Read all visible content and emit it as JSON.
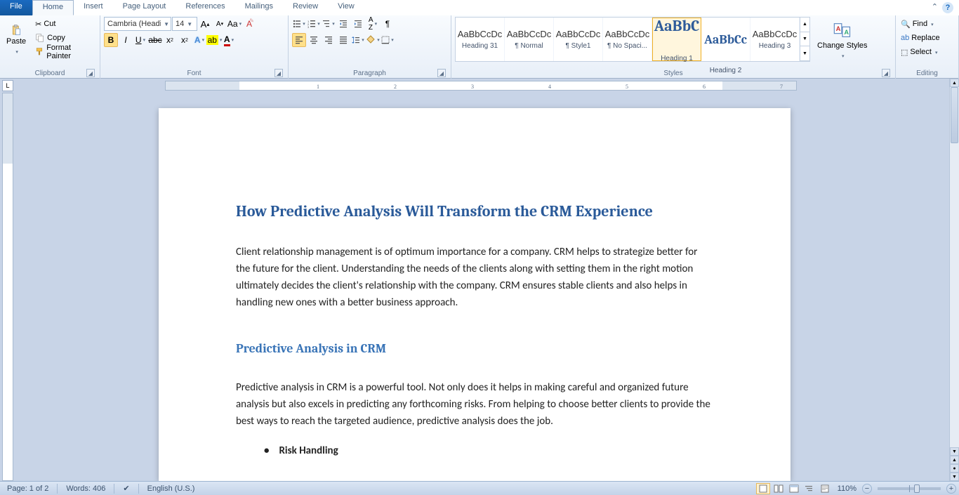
{
  "tabs": {
    "file": "File",
    "list": [
      "Home",
      "Insert",
      "Page Layout",
      "References",
      "Mailings",
      "Review",
      "View"
    ],
    "active": "Home"
  },
  "clipboard": {
    "paste": "Paste",
    "cut": "Cut",
    "copy": "Copy",
    "format_painter": "Format Painter",
    "group": "Clipboard"
  },
  "font": {
    "name": "Cambria (Headi",
    "size": "14",
    "group": "Font"
  },
  "paragraph": {
    "group": "Paragraph"
  },
  "styles": {
    "group": "Styles",
    "change": "Change Styles",
    "items": [
      {
        "prev": "AaBbCcDc",
        "name": "Heading 31",
        "cls": ""
      },
      {
        "prev": "AaBbCcDc",
        "name": "¶ Normal",
        "cls": ""
      },
      {
        "prev": "AaBbCcDc",
        "name": "¶ Style1",
        "cls": ""
      },
      {
        "prev": "AaBbCcDc",
        "name": "¶ No Spaci...",
        "cls": ""
      },
      {
        "prev": "AaBbC",
        "name": "Heading 1",
        "cls": "h1"
      },
      {
        "prev": "AaBbCc",
        "name": "Heading 2",
        "cls": "h2"
      },
      {
        "prev": "AaBbCcDc",
        "name": "Heading 3",
        "cls": ""
      }
    ],
    "active_index": 4
  },
  "editing": {
    "find": "Find",
    "replace": "Replace",
    "select": "Select",
    "group": "Editing"
  },
  "document": {
    "title": "How Predictive Analysis Will Transform the CRM Experience",
    "p1": "Client relationship management is of optimum importance for a company. CRM helps to strategize better for the future for the client. Understanding  the needs of the clients along with setting them in the right motion ultimately decides the client's relationship with the company. CRM ensures stable clients and also helps in handling new ones with a better business approach.",
    "h2": "Predictive Analysis in CRM",
    "p2": "Predictive analysis in CRM is a powerful  tool.  Not only does it helps in making careful and organized future analysis but also excels in predicting any forthcoming risks. From helping to choose better clients to provide the best ways to reach the targeted audience, predictive analysis does the job.",
    "b1": "Risk Handling"
  },
  "status": {
    "page": "Page: 1 of 2",
    "words": "Words: 406",
    "lang": "English (U.S.)",
    "zoom": "110%"
  }
}
